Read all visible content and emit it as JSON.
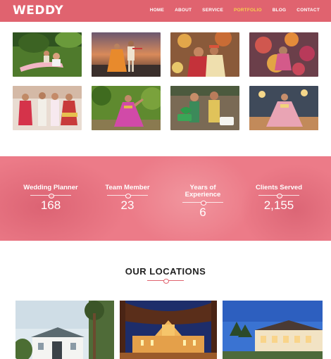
{
  "header": {
    "logo": "WEDDY",
    "nav": [
      "HOME",
      "ABOUT",
      "SERVICE",
      "PORTFOLIO",
      "BLOG",
      "CONTACT"
    ],
    "active": "PORTFOLIO"
  },
  "gallery": {
    "thumbs": [
      {
        "name": "couple-on-grass-photo"
      },
      {
        "name": "couple-sunset-photo"
      },
      {
        "name": "bride-groom-floral-photo"
      },
      {
        "name": "floral-decor-photo"
      },
      {
        "name": "bride-family-photo"
      },
      {
        "name": "bride-dance-photo"
      },
      {
        "name": "couple-sign-photo"
      },
      {
        "name": "bride-stage-photo"
      }
    ]
  },
  "stats": [
    {
      "label": "Wedding Planner",
      "value": "168"
    },
    {
      "label": "Team Member",
      "value": "23"
    },
    {
      "label": "Years of Experience",
      "value": "6"
    },
    {
      "label": "Clients Served",
      "value": "2,155"
    }
  ],
  "locations": {
    "title": "OUR LOCATIONS"
  },
  "colors": {
    "brand": "#e0636f",
    "active_nav": "#f6d04d",
    "banner": "#ec7b88"
  }
}
